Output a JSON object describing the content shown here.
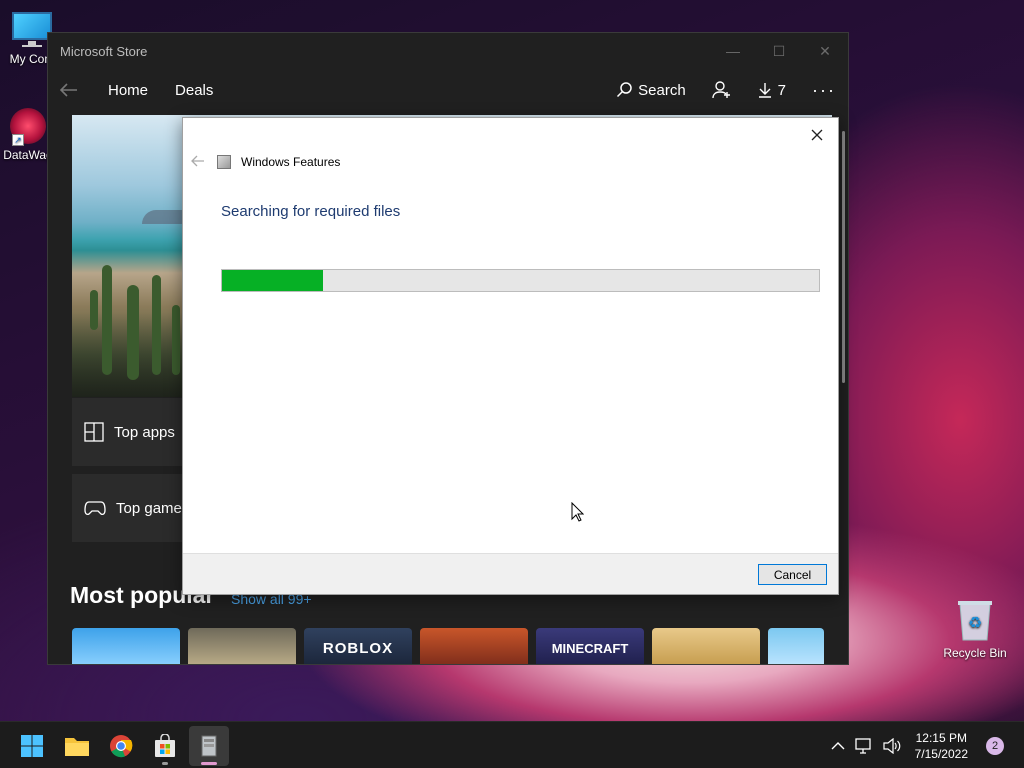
{
  "desktop": {
    "icons": [
      {
        "label": "My Com"
      },
      {
        "label": "DataWag"
      }
    ],
    "recycle_bin": {
      "label": "Recycle Bin"
    }
  },
  "store": {
    "title": "Microsoft Store",
    "nav": {
      "home": "Home",
      "deals": "Deals",
      "search": "Search",
      "downloads_count": "7"
    },
    "side_cards": [
      {
        "label": "Top apps",
        "icon": "grid-icon"
      },
      {
        "label": "Top games",
        "icon": "gamepad-icon"
      }
    ],
    "most_popular": "Most popular",
    "show_all": "Show all 99+",
    "tiles": [
      "",
      "",
      "ROBLOX",
      "",
      "MINECRAFT",
      "",
      ""
    ]
  },
  "dialog": {
    "header": "Windows Features",
    "status": "Searching for required files",
    "progress": 0.17,
    "cancel": "Cancel",
    "colors": {
      "progress": "#06b025",
      "title": "#1e3b70"
    }
  },
  "taskbar": {
    "time": "12:15 PM",
    "date": "7/15/2022",
    "notifications": "2"
  }
}
